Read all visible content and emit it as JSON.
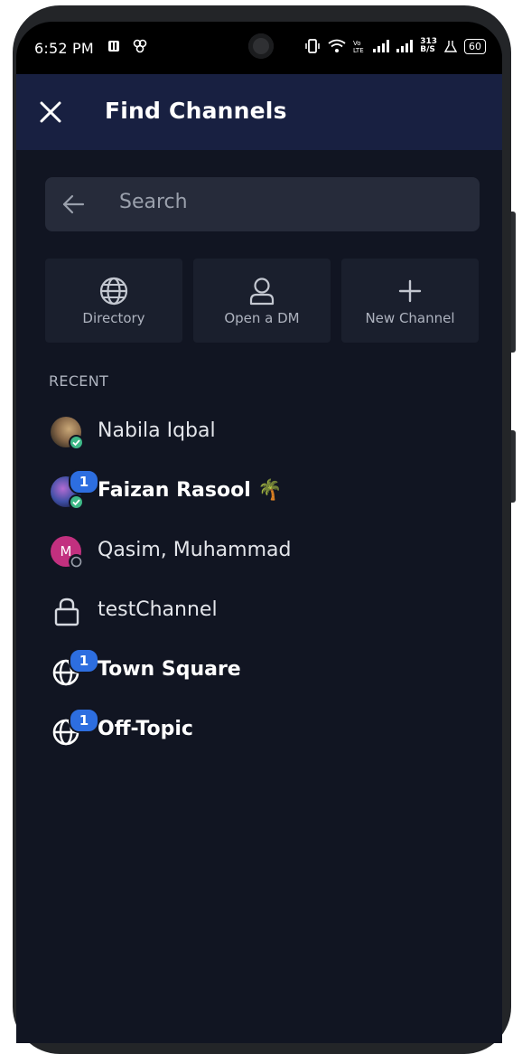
{
  "status_bar": {
    "time": "6:52 PM",
    "network": "313\nB/S",
    "battery": "60"
  },
  "header": {
    "close_icon": "close-icon",
    "title": "Find Channels"
  },
  "search": {
    "placeholder": "Search",
    "back_icon": "arrow-left-icon"
  },
  "actions": [
    {
      "label": "Directory",
      "icon": "globe-icon"
    },
    {
      "label": "Open a DM",
      "icon": "person-icon"
    },
    {
      "label": "New Channel",
      "icon": "plus-icon"
    }
  ],
  "recent": {
    "heading": "RECENT",
    "items": [
      {
        "label": "Nabila Iqbal",
        "type": "dm",
        "status": "online",
        "unread": null,
        "bold": false
      },
      {
        "label": "Faizan Rasool 🌴",
        "type": "dm",
        "status": "online",
        "unread": "1",
        "bold": true
      },
      {
        "label": "Qasim, Muhammad",
        "type": "dm",
        "avatar_initial": "M",
        "status": "offline",
        "unread": null,
        "bold": false
      },
      {
        "label": "testChannel",
        "type": "private",
        "unread": null,
        "bold": false
      },
      {
        "label": "Town Square",
        "type": "public",
        "unread": "1",
        "bold": true
      },
      {
        "label": "Off-Topic",
        "type": "public",
        "unread": "1",
        "bold": true
      }
    ]
  },
  "colors": {
    "background": "#111522",
    "header": "#182041",
    "accent_badge": "#2d6ee0",
    "online": "#3db887"
  }
}
